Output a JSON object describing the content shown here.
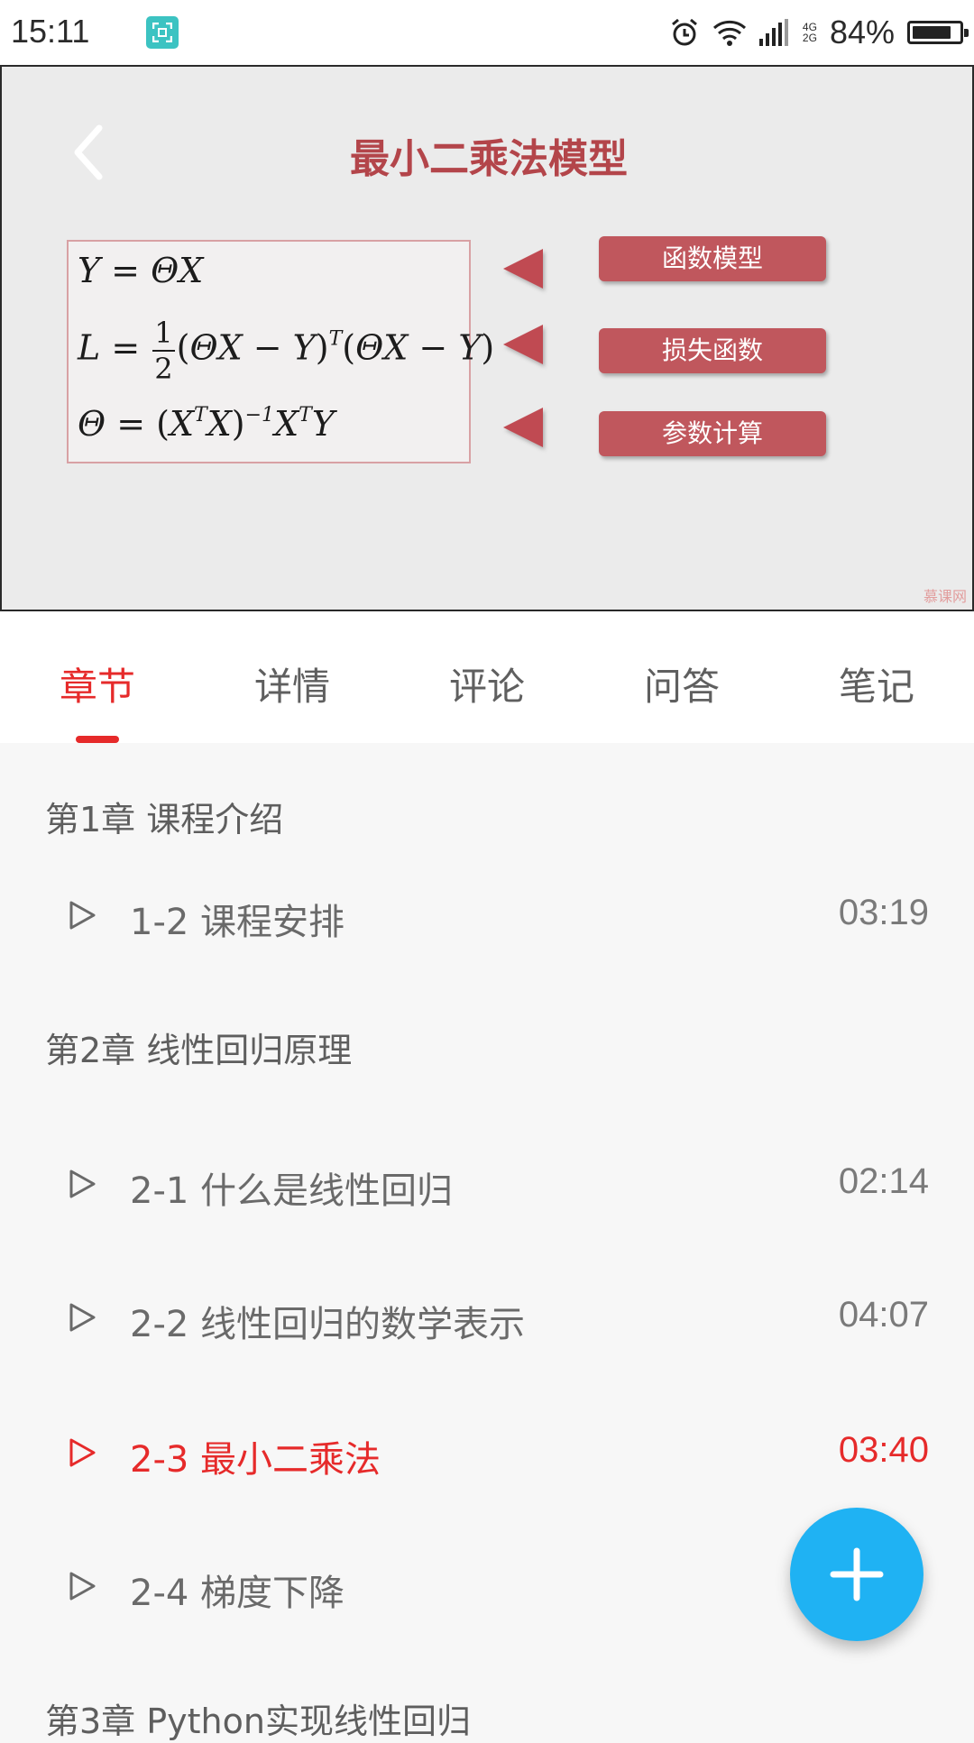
{
  "status_bar": {
    "time": "15:11",
    "network_top": "4G",
    "network_bottom": "2G",
    "battery_percent": "84%",
    "battery_level": 0.84
  },
  "video": {
    "slide_title": "最小二乘法模型",
    "formulas": [
      "Y = ΘX",
      "L = 1/2 (ΘX − Y)^T (ΘX − Y)",
      "Θ = (X^T X)^−1 X^T Y"
    ],
    "buttons": [
      "函数模型",
      "损失函数",
      "参数计算"
    ],
    "watermark": "慕课网"
  },
  "tabs": [
    {
      "label": "章节",
      "active": true
    },
    {
      "label": "详情",
      "active": false
    },
    {
      "label": "评论",
      "active": false
    },
    {
      "label": "问答",
      "active": false
    },
    {
      "label": "笔记",
      "active": false
    }
  ],
  "chapters": [
    {
      "title": "第1章 课程介绍"
    },
    {
      "title": "第2章 线性回归原理"
    },
    {
      "title": "第3章 Python实现线性回归"
    }
  ],
  "lessons": [
    {
      "title": "1-2 课程安排",
      "duration": "03:19"
    },
    {
      "title": "2-1 什么是线性回归",
      "duration": "02:14"
    },
    {
      "title": "2-2 线性回归的数学表示",
      "duration": "04:07"
    },
    {
      "title": "2-3 最小二乘法",
      "duration": "03:40",
      "active": true
    },
    {
      "title": "2-4 梯度下降",
      "duration": ""
    }
  ],
  "colors": {
    "accent": "#e62a2a",
    "fab": "#1fb2f3",
    "slide_red": "#c0575d"
  }
}
